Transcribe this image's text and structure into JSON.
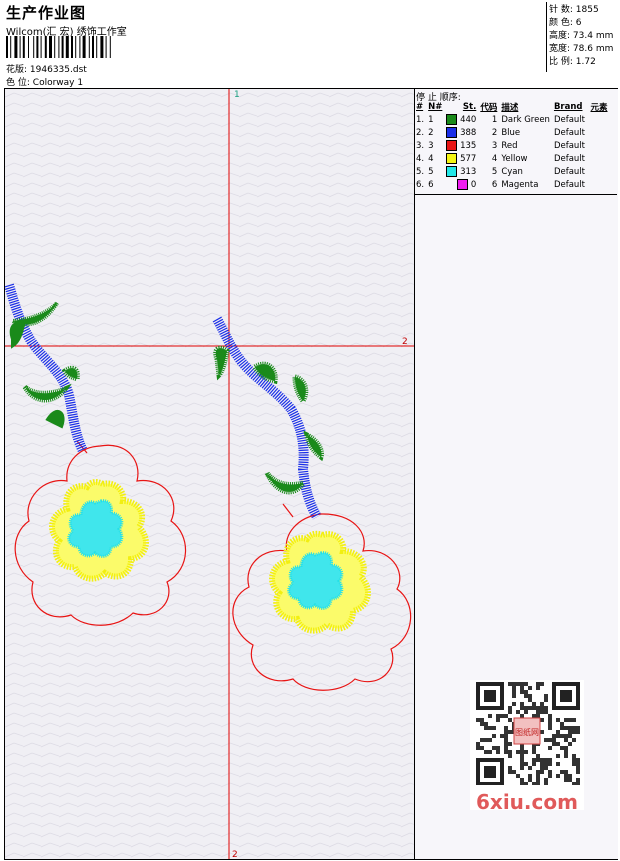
{
  "header": {
    "title": "生产作业图",
    "company": "Wilcom(汇 宏) 绣饰工作室",
    "design_label": "花版:",
    "design_value": "1946335.dst",
    "colorway_label": "色 位:",
    "colorway_value": "Colorway 1"
  },
  "stats": [
    {
      "label": "针 数:",
      "value": "1855"
    },
    {
      "label": "颜 色:",
      "value": "6"
    },
    {
      "label": "高度:",
      "value": "73.4 mm"
    },
    {
      "label": "宽度:",
      "value": "78.6 mm"
    },
    {
      "label": "比 例:",
      "value": "1.72"
    }
  ],
  "stop_sequence": {
    "title": "停 止 顺序:",
    "columns": [
      "#",
      "N#",
      "St.",
      "代码",
      "描述",
      "Brand",
      "元素"
    ],
    "rows": [
      {
        "idx": "1.",
        "n": "1",
        "color": "#1a8a1a",
        "st": "440",
        "code": "1",
        "desc": "Dark Green",
        "brand": "Default"
      },
      {
        "idx": "2.",
        "n": "2",
        "color": "#1a2ee8",
        "st": "388",
        "code": "2",
        "desc": "Blue",
        "brand": "Default"
      },
      {
        "idx": "3.",
        "n": "3",
        "color": "#e81414",
        "st": "135",
        "code": "3",
        "desc": "Red",
        "brand": "Default"
      },
      {
        "idx": "4.",
        "n": "4",
        "color": "#f5f514",
        "st": "577",
        "code": "4",
        "desc": "Yellow",
        "brand": "Default"
      },
      {
        "idx": "5.",
        "n": "5",
        "color": "#22e8e8",
        "st": "313",
        "code": "5",
        "desc": "Cyan",
        "brand": "Default"
      },
      {
        "idx": "6.",
        "n": "6",
        "color": "#f01ef0",
        "st": "0",
        "code": "6",
        "desc": "Magenta",
        "brand": "Default"
      }
    ]
  },
  "canvas_markers": {
    "top": "1",
    "right": "2",
    "bottom": "2"
  },
  "colors": {
    "guide_line": "#e00000",
    "green": "#1a8a1a",
    "blue": "#1a2ee8",
    "red": "#e81414",
    "yellow": "#f5f514",
    "cyan": "#22e8e8"
  },
  "watermark": {
    "brand": "6xiu.com",
    "seal": "图纸网"
  }
}
